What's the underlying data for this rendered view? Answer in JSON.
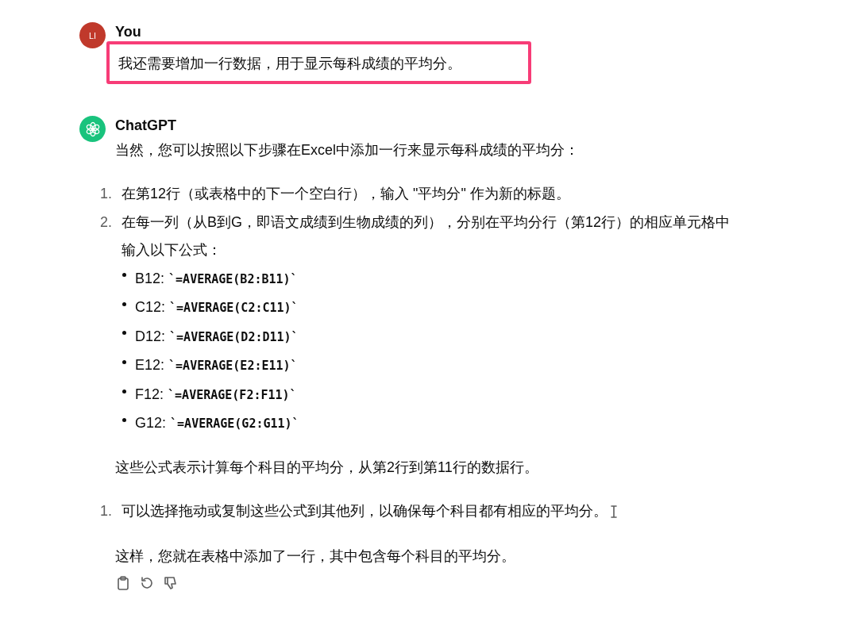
{
  "user": {
    "avatar": "LI",
    "name": "You",
    "message": "我还需要增加一行数据，用于显示每科成绩的平均分。",
    "highlighted": true
  },
  "assistant": {
    "name": "ChatGPT",
    "intro": "当然，您可以按照以下步骤在Excel中添加一行来显示每科成绩的平均分：",
    "steps": [
      {
        "number": "1.",
        "text": "在第12行（或表格中的下一个空白行），输入 \"平均分\" 作为新的标题。"
      },
      {
        "number": "2.",
        "text": "在每一列（从B到G，即语文成绩到生物成绩的列），分别在平均分行（第12行）的相应单元格中输入以下公式：",
        "formulas": [
          {
            "cell": "B12:",
            "code": "`=AVERAGE(B2:B11)`"
          },
          {
            "cell": "C12:",
            "code": "`=AVERAGE(C2:C11)`"
          },
          {
            "cell": "D12:",
            "code": "`=AVERAGE(D2:D11)`"
          },
          {
            "cell": "E12:",
            "code": "`=AVERAGE(E2:E11)`"
          },
          {
            "cell": "F12:",
            "code": "`=AVERAGE(F2:F11)`"
          },
          {
            "cell": "G12:",
            "code": "`=AVERAGE(G2:G11)`"
          }
        ]
      }
    ],
    "note": "这些公式表示计算每个科目的平均分，从第2行到第11行的数据行。",
    "more_steps": [
      {
        "number": "1.",
        "text": "可以选择拖动或复制这些公式到其他列，以确保每个科目都有相应的平均分。"
      }
    ],
    "closing": "这样，您就在表格中添加了一行，其中包含每个科目的平均分。"
  }
}
